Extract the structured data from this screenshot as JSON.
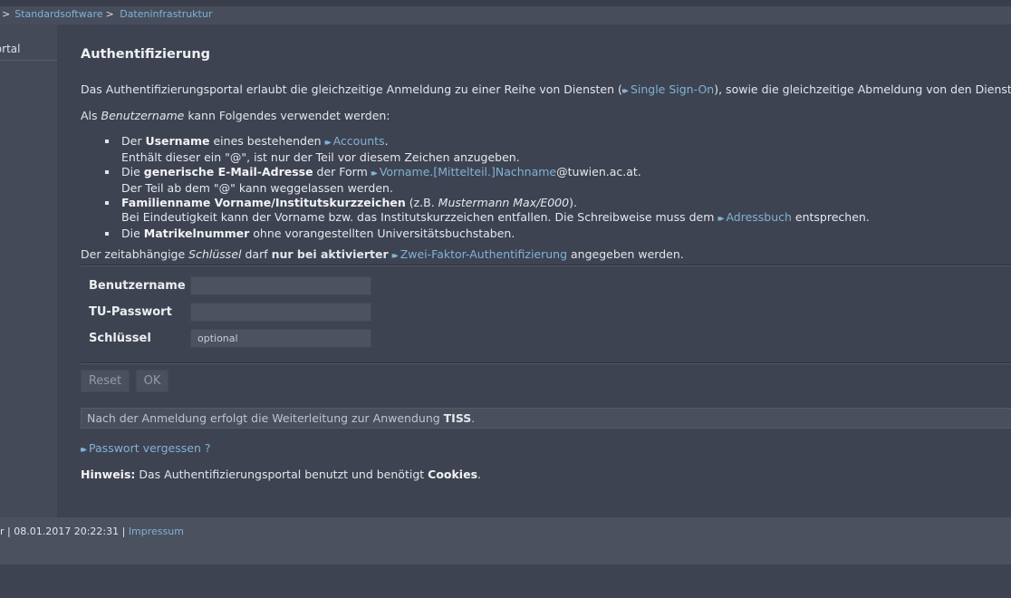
{
  "breadcrumb": {
    "sep": ">",
    "items": [
      "Standardsoftware",
      "Dateninfrastruktur"
    ]
  },
  "sidebar": {
    "item": "Portal"
  },
  "main": {
    "title": "Authentifizierung",
    "intro": {
      "before": "Das Authentifizierungsportal erlaubt die gleichzeitige Anmeldung zu einer Reihe von Diensten (",
      "link": "Single Sign-On",
      "after": "), sowie die gleichzeitige Abmeldung von den Diensten."
    },
    "uname_intro": {
      "a": "Als ",
      "em": "Benutzername",
      "b": " kann Folgendes verwendet werden:"
    },
    "bullets": [
      {
        "a": "Der ",
        "b": "Username",
        "c": " eines bestehenden ",
        "link": "Accounts",
        "d": ".",
        "line2": "Enthält dieser ein \"@\", ist nur der Teil vor diesem Zeichen anzugeben."
      },
      {
        "a": "Die ",
        "b": "generische E-Mail-Adresse",
        "c": " der Form ",
        "link": "Vorname.[Mittelteil.]Nachname",
        "d": "@tuwien.ac.at.",
        "line2": "Der Teil ab dem \"@\" kann weggelassen werden."
      },
      {
        "b": "Familienname Vorname/Institutskurzzeichen",
        "c": " (z.B. ",
        "em": "Mustermann Max/E000",
        "d": ").",
        "line2a": "Bei Eindeutigkeit kann der Vorname bzw. das Institutskurzzeichen entfallen. Die Schreibweise muss dem ",
        "link": "Adressbuch",
        "line2b": " entsprechen."
      },
      {
        "a": "Die ",
        "b": "Matrikelnummer",
        "c": " ohne vorangestellten Universitätsbuchstaben."
      }
    ],
    "key_note": {
      "a": "Der zeitabhängige ",
      "em": "Schlüssel",
      "b": " darf ",
      "strong": "nur bei aktivierter",
      "link": "Zwei-Faktor-Authentifizierung",
      "c": " angegeben werden."
    },
    "form": {
      "username_label": "Benutzername",
      "password_label": "TU-Passwort",
      "key_label": "Schlüssel",
      "key_placeholder": "optional",
      "reset_label": "Reset",
      "ok_label": "OK"
    },
    "redirect": {
      "text": "Nach der Anmeldung erfolgt die Weiterleitung zur Anwendung ",
      "app": "TISS",
      "end": "."
    },
    "forgot_link": "Passwort vergessen ?",
    "hint": {
      "label": "Hinweis:",
      "text": " Das Authentifizierungsportal benutzt und benötigt ",
      "bold": "Cookies",
      "end": "."
    }
  },
  "footer": {
    "text": "r | 08.01.2017 20:22:31 | ",
    "link": "Impressum"
  },
  "colors": {
    "accent_link": "#7fb3d5",
    "background": "#3e4351"
  }
}
